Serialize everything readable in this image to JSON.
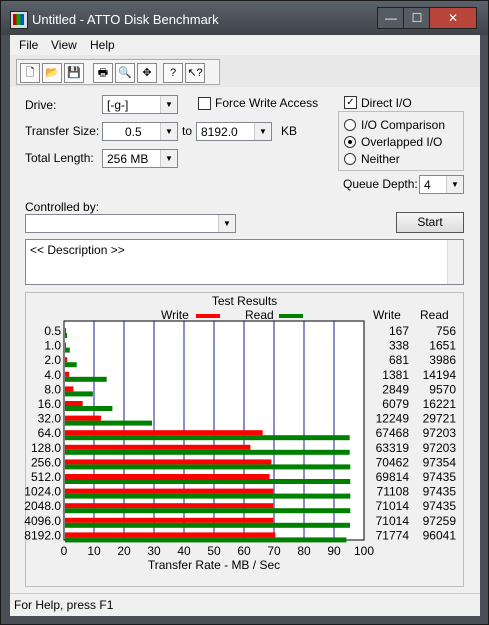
{
  "window": {
    "title": "Untitled - ATTO Disk Benchmark",
    "min_label": "—",
    "max_label": "☐",
    "close_label": "✕"
  },
  "menus": [
    "File",
    "View",
    "Help"
  ],
  "toolbar": {
    "icons": [
      "new-icon",
      "open-icon",
      "save-icon",
      "print-icon",
      "print-preview-icon",
      "move-icon",
      "help-icon",
      "context-help-icon"
    ]
  },
  "form": {
    "drive_label": "Drive:",
    "drive_value": "[-g-]",
    "force_write_access": {
      "label": "Force Write Access",
      "checked": false
    },
    "direct_io": {
      "label": "Direct I/O",
      "checked": true
    },
    "transfer_size_label": "Transfer Size:",
    "transfer_from": "0.5",
    "to_label": "to",
    "transfer_to": "8192.0",
    "kb_label": "KB",
    "total_length_label": "Total Length:",
    "total_length": "256 MB",
    "io_comparison": "I/O Comparison",
    "overlapped_io": "Overlapped I/O",
    "neither": "Neither",
    "queue_depth_label": "Queue Depth:",
    "queue_depth": "4",
    "controlled_by_label": "Controlled by:",
    "controlled_by": "",
    "start_label": "Start",
    "description": "<< Description >>"
  },
  "results": {
    "title": "Test Results",
    "write_header": "Write",
    "read_header": "Read",
    "write_legend": "Write",
    "read_legend": "Read"
  },
  "chart_data": {
    "type": "bar",
    "title": "Test Results",
    "xlabel": "Transfer Rate - MB / Sec",
    "xlim": [
      0,
      100
    ],
    "x_ticks": [
      "0",
      "10",
      "20",
      "30",
      "40",
      "50",
      "60",
      "70",
      "80",
      "90",
      "100"
    ],
    "categories": [
      "0.5",
      "1.0",
      "2.0",
      "4.0",
      "8.0",
      "16.0",
      "32.0",
      "64.0",
      "128.0",
      "256.0",
      "512.0",
      "1024.0",
      "2048.0",
      "4096.0",
      "8192.0"
    ],
    "series": [
      {
        "name": "Write",
        "color": "#ff0000",
        "values": [
          0.2,
          0.3,
          0.7,
          1.4,
          2.8,
          5.9,
          12.0,
          65.9,
          61.8,
          68.8,
          68.2,
          69.4,
          69.4,
          69.4,
          70.1
        ]
      },
      {
        "name": "Read",
        "color": "#008000",
        "values": [
          0.7,
          1.6,
          3.9,
          13.9,
          9.3,
          15.8,
          29.0,
          94.9,
          94.9,
          95.1,
          95.1,
          95.1,
          95.1,
          95.0,
          93.8
        ]
      }
    ],
    "write_text": [
      "167",
      "338",
      "681",
      "1381",
      "2849",
      "6079",
      "12249",
      "67468",
      "63319",
      "70462",
      "69814",
      "71108",
      "71014",
      "71014",
      "71774"
    ],
    "read_text": [
      "756",
      "1651",
      "3986",
      "14194",
      "9570",
      "16221",
      "29721",
      "97203",
      "97203",
      "97354",
      "97435",
      "97435",
      "97435",
      "97259",
      "96041"
    ]
  },
  "status": "For Help, press F1"
}
